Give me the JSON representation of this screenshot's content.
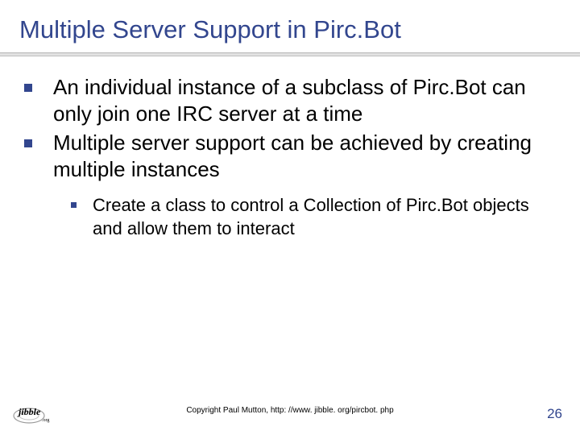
{
  "title": "Multiple Server Support in Pirc.Bot",
  "bullets": {
    "b1": "An individual instance of a subclass of Pirc.Bot can only join one IRC server at a time",
    "b2": "Multiple server support can be achieved by creating multiple instances",
    "b2a": "Create a class to control a Collection of Pirc.Bot objects and allow them to interact"
  },
  "footer": {
    "copyright": "Copyright Paul Mutton, http: //www. jibble. org/pircbot. php",
    "page": "26",
    "logo_text": "jibble",
    "logo_sub": ".org"
  }
}
